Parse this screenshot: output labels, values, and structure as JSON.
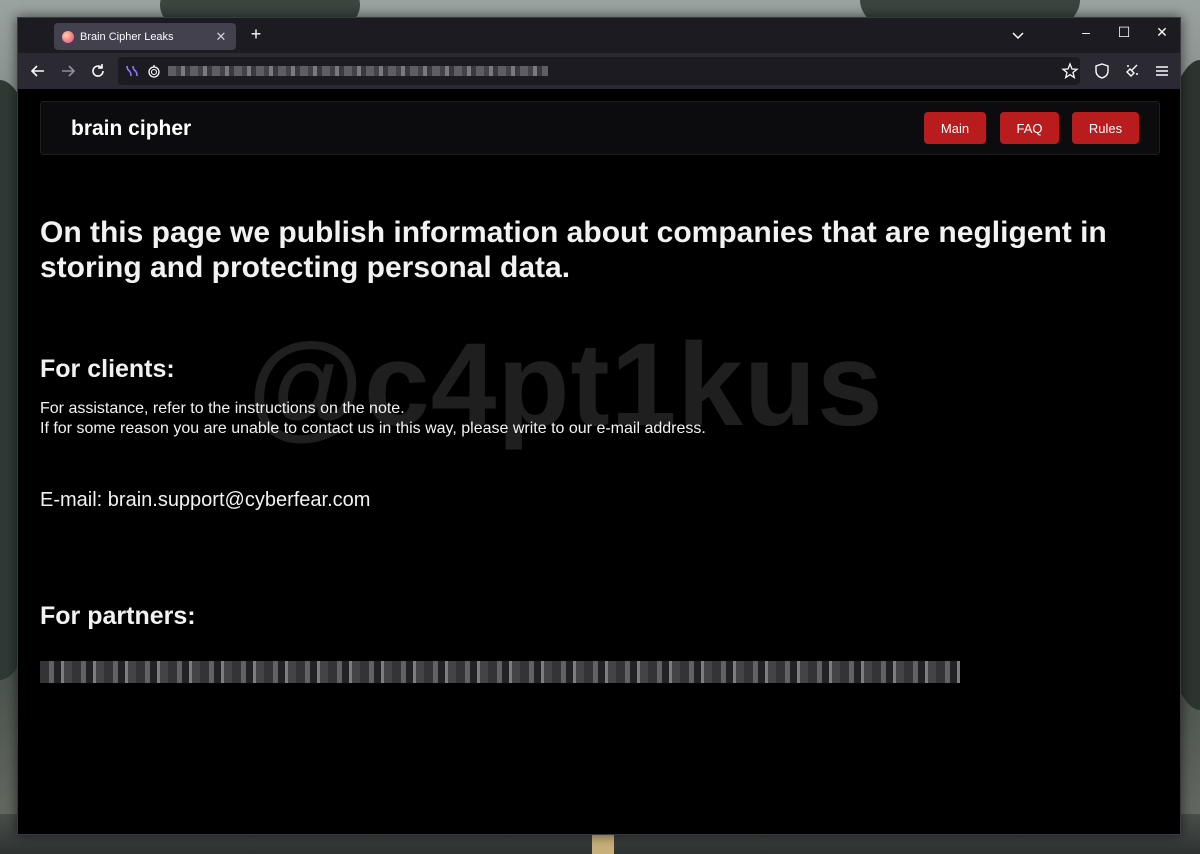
{
  "browser": {
    "tab_title": "Brain Cipher Leaks",
    "tab_close": "✕",
    "new_tab": "+",
    "tablist": "⌄",
    "win_minimize": "–",
    "win_maximize": "☐",
    "win_close": "✕"
  },
  "navbar": {
    "brand": "brain cipher",
    "links": [
      "Main",
      "FAQ",
      "Rules"
    ]
  },
  "watermark": "@c4pt1kus",
  "page": {
    "headline": "On this page we publish information about companies that are negligent in storing and protecting personal data.",
    "clients_heading": "For clients:",
    "clients_line1": "For assistance, refer to the instructions on the note.",
    "clients_line2": "If for some reason you are unable to contact us in this way, please write to our e-mail address.",
    "email": "E-mail: brain.support@cyberfear.com",
    "partners_heading": "For partners:"
  },
  "colors": {
    "accent": "#b81c1c",
    "background": "#000000",
    "chrome": "#2b2a33"
  }
}
